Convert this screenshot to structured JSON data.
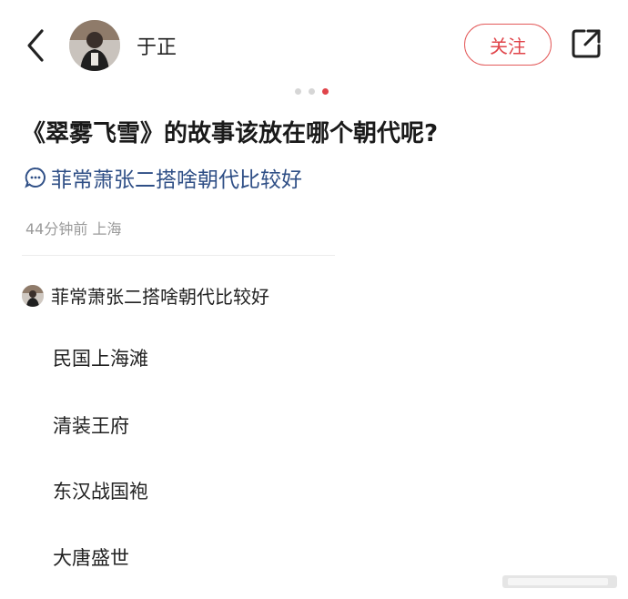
{
  "header": {
    "author_name": "于正",
    "follow_label": "关注"
  },
  "pager": {
    "count": 3,
    "active_index": 2
  },
  "post": {
    "title": "《翠雾飞雪》的故事该放在哪个朝代呢?",
    "topic": "菲常萧张二搭啥朝代比较好",
    "meta": "44分钟前 上海"
  },
  "vote": {
    "title": "菲常萧张二搭啥朝代比较好",
    "options": [
      "民国上海滩",
      "清装王府",
      "东汉战国袍",
      "大唐盛世"
    ]
  },
  "colors": {
    "accent": "#e0444a",
    "topic": "#2f4f86",
    "meta": "#9a9a9a"
  },
  "icons": {
    "back": "chevron-left-icon",
    "share": "share-icon",
    "topic": "chat-bubble-icon"
  }
}
